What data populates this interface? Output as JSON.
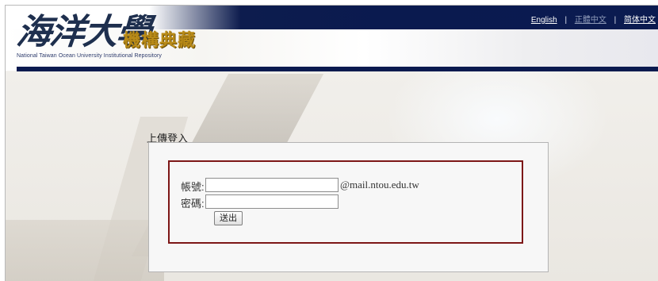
{
  "header": {
    "logo_calligraphy": "海洋大學",
    "logo_gold": "機構典藏",
    "logo_subtitle": "National Taiwan Ocean University Institutional Repository",
    "languages": [
      {
        "label": "English"
      },
      {
        "label": "正體中文"
      },
      {
        "label": "简体中文"
      }
    ],
    "separator": "|"
  },
  "login": {
    "title": "上傳登入",
    "account_label": "帳號:",
    "account_value": "",
    "account_suffix": "@mail.ntou.edu.tw",
    "password_label": "密碼:",
    "password_value": "",
    "submit_label": "送出"
  },
  "colors": {
    "header_navy": "#0a1a4f",
    "box_border": "#7d1717",
    "logo_gold": "#b98b18"
  }
}
